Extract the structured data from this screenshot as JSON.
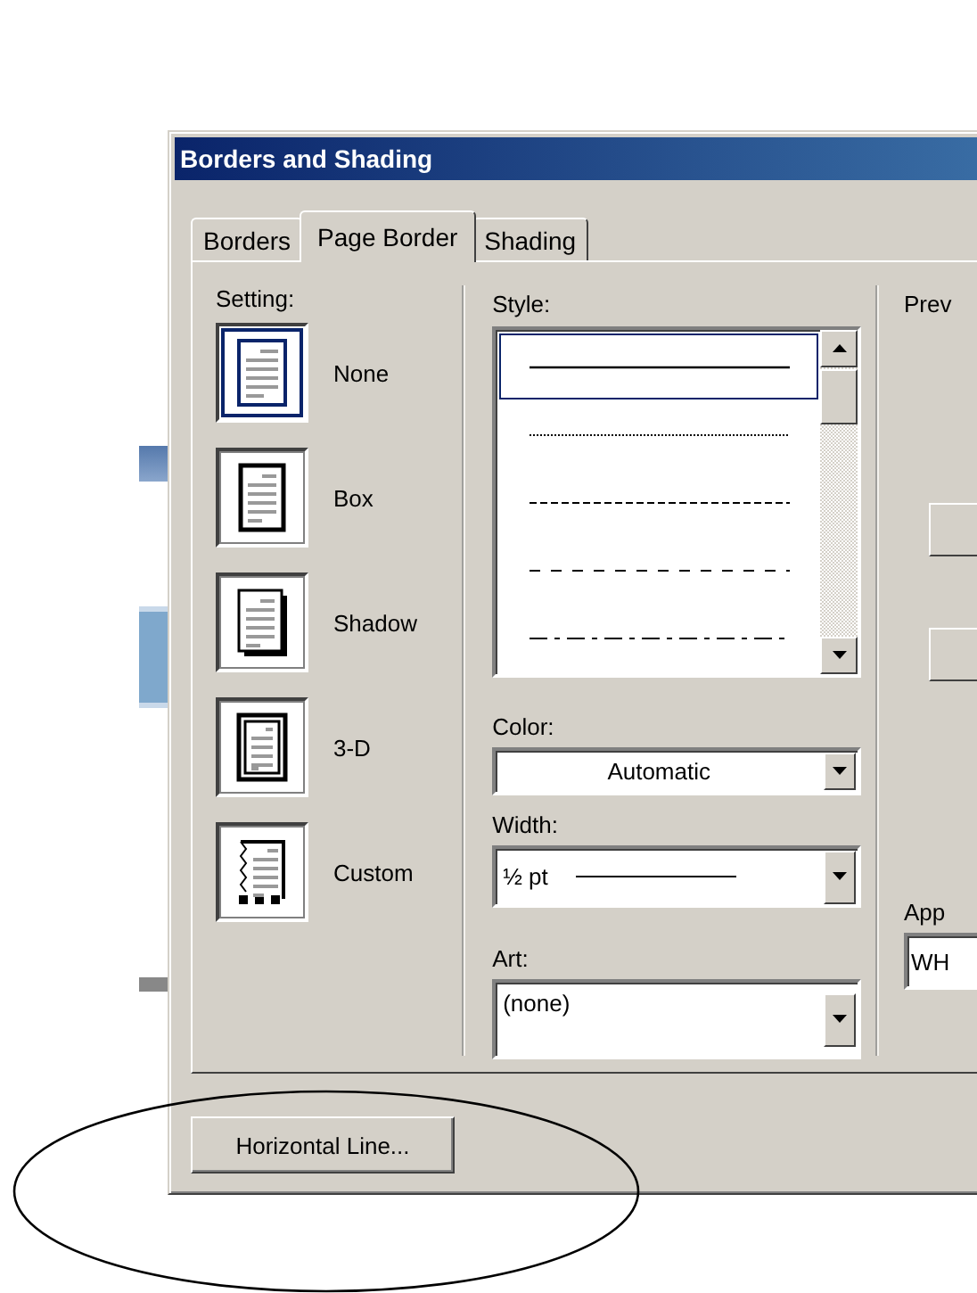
{
  "background_document": {
    "fragments": [
      {
        "kind": "bar"
      },
      {
        "kind": "banner"
      },
      {
        "kind": "rule"
      }
    ]
  },
  "dialog": {
    "title": "Borders and Shading",
    "tabs": [
      {
        "label": "Borders",
        "selected": false
      },
      {
        "label": "Page Border",
        "selected": true
      },
      {
        "label": "Shading",
        "selected": false
      }
    ],
    "setting": {
      "label": "Setting:",
      "options": [
        {
          "label": "None",
          "kind": "none",
          "selected": true
        },
        {
          "label": "Box",
          "kind": "box",
          "selected": false
        },
        {
          "label": "Shadow",
          "kind": "shadow",
          "selected": false
        },
        {
          "label": "3-D",
          "kind": "framed",
          "selected": false
        },
        {
          "label": "Custom",
          "kind": "custom",
          "selected": false
        }
      ]
    },
    "style": {
      "label": "Style:",
      "items": [
        {
          "kind": "solid",
          "selected": true
        },
        {
          "kind": "dotted",
          "selected": false
        },
        {
          "kind": "dashed",
          "selected": false
        },
        {
          "kind": "long-dashed",
          "selected": false
        },
        {
          "kind": "dash-dot",
          "selected": false
        }
      ]
    },
    "color": {
      "label": "Color:",
      "value": "Automatic"
    },
    "width": {
      "label": "Width:",
      "value": "½ pt"
    },
    "art": {
      "label": "Art:",
      "value": "(none)"
    },
    "preview": {
      "label": "Prev"
    },
    "apply_to": {
      "label": "App",
      "value": "WH"
    },
    "buttons": [
      {
        "label": "Horizontal Line..."
      }
    ]
  },
  "annotation": {
    "kind": "ellipse"
  }
}
